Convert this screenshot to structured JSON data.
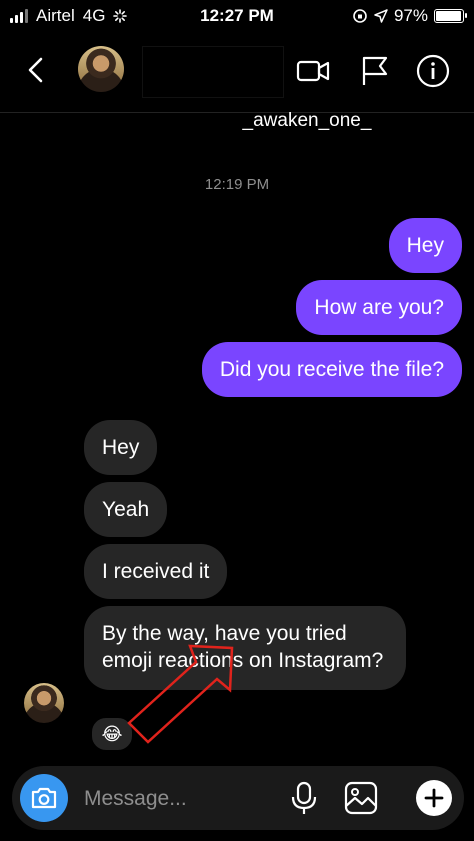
{
  "status_bar": {
    "carrier": "Airtel",
    "network": "4G",
    "time": "12:27 PM",
    "battery_percent": "97%",
    "battery_level": 0.97
  },
  "header": {
    "back_icon": "chevron-left-icon",
    "video_icon": "video-call-icon",
    "flag_icon": "flag-icon",
    "info_icon": "info-icon"
  },
  "thread": {
    "username": "_awaken_one_",
    "timestamp": "12:19 PM",
    "sent": [
      "Hey",
      "How are you?",
      "Did you receive the file?"
    ],
    "received": [
      "Hey",
      "Yeah",
      "I received it",
      "By the way, have you tried emoji reactions on Instagram?"
    ],
    "reaction": "😂"
  },
  "composer": {
    "placeholder": "Message...",
    "camera_icon": "camera-icon",
    "mic_icon": "microphone-icon",
    "gallery_icon": "image-icon",
    "add_icon": "plus-icon"
  },
  "colors": {
    "sent_bubble": "#7a45ff",
    "received_bubble": "#262626",
    "camera_button": "#3897f0",
    "annotation_arrow": "#e0231c"
  }
}
